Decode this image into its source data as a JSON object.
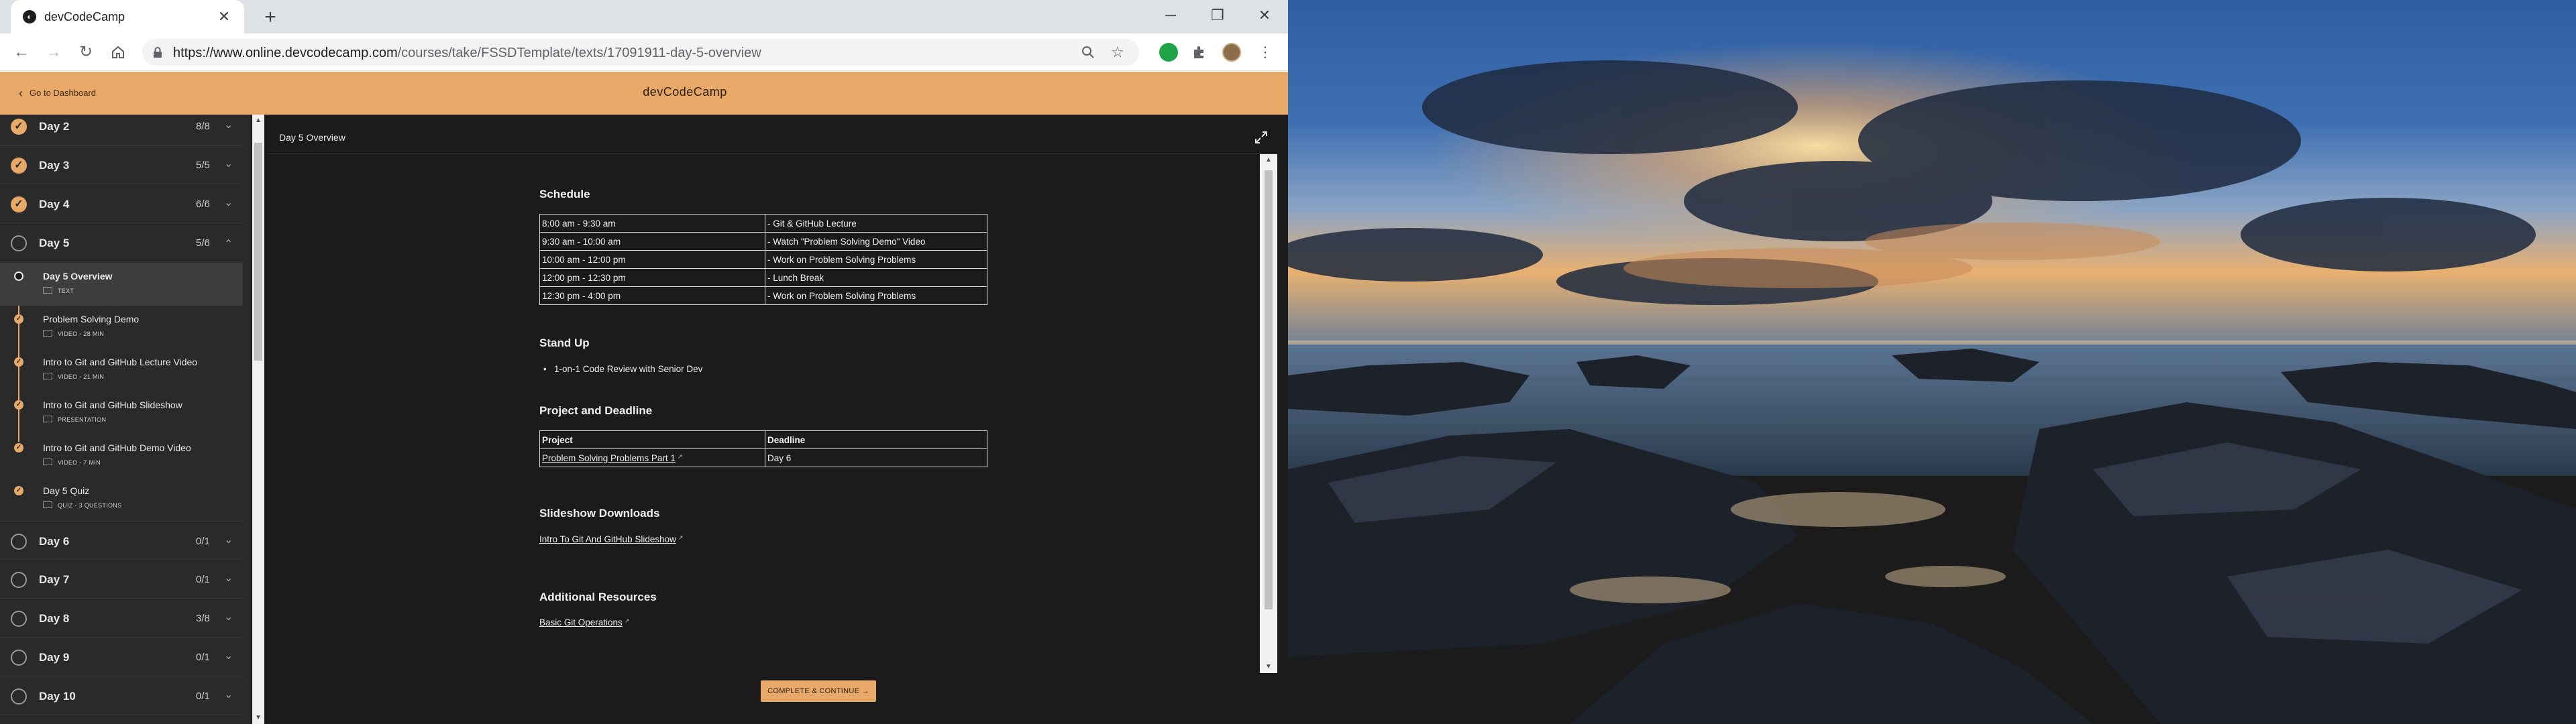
{
  "browser": {
    "tab_title": "devCodeCamp",
    "url_host": "https://www.online.devcodecamp.com",
    "url_path": "/courses/take/FSSDTemplate/texts/17091911-day-5-overview",
    "new_tab": "+",
    "close_tab": "✕",
    "window_controls": {
      "minimize": "─",
      "restore": "❐",
      "close": "✕"
    }
  },
  "app": {
    "brand": "devCodeCamp",
    "dashboard_link": "Go to Dashboard"
  },
  "sidebar": {
    "days": [
      {
        "label": "Day 2",
        "count": "8/8",
        "status": "done"
      },
      {
        "label": "Day 3",
        "count": "5/5",
        "status": "done"
      },
      {
        "label": "Day 4",
        "count": "6/6",
        "status": "done"
      },
      {
        "label": "Day 5",
        "count": "5/6",
        "status": "open",
        "expanded": true
      },
      {
        "label": "Day 6",
        "count": "0/1",
        "status": "open"
      },
      {
        "label": "Day 7",
        "count": "0/1",
        "status": "open"
      },
      {
        "label": "Day 8",
        "count": "3/8",
        "status": "open"
      },
      {
        "label": "Day 9",
        "count": "0/1",
        "status": "open"
      },
      {
        "label": "Day 10",
        "count": "0/1",
        "status": "open"
      }
    ],
    "lessons": [
      {
        "title": "Day 5 Overview",
        "meta": "TEXT",
        "state": "current"
      },
      {
        "title": "Problem Solving Demo",
        "meta": "VIDEO - 28 MIN",
        "state": "done"
      },
      {
        "title": "Intro to Git and GitHub Lecture Video",
        "meta": "VIDEO - 21 MIN",
        "state": "done"
      },
      {
        "title": "Intro to Git and GitHub Slideshow",
        "meta": "PRESENTATION",
        "state": "done"
      },
      {
        "title": "Intro to Git and GitHub Demo Video",
        "meta": "VIDEO - 7 MIN",
        "state": "done"
      },
      {
        "title": "Day 5 Quiz",
        "meta": "QUIZ - 3 QUESTIONS",
        "state": "done"
      }
    ]
  },
  "content": {
    "title": "Day 5 Overview",
    "schedule": {
      "heading": "Schedule",
      "rows": [
        [
          "8:00 am - 9:30 am",
          "- Git & GitHub Lecture"
        ],
        [
          "9:30 am - 10:00 am",
          "- Watch \"Problem Solving Demo\" Video"
        ],
        [
          "10:00 am - 12:00 pm",
          "- Work on Problem Solving Problems"
        ],
        [
          "12:00 pm - 12:30 pm",
          "- Lunch Break"
        ],
        [
          "12:30 pm - 4:00 pm",
          "- Work on Problem Solving Problems"
        ]
      ]
    },
    "standup": {
      "heading": "Stand Up",
      "items": [
        "1-on-1 Code Review with Senior Dev"
      ]
    },
    "project": {
      "heading": "Project and Deadline",
      "col_project": "Project",
      "col_deadline": "Deadline",
      "rows": [
        [
          "Problem Solving Problems Part 1",
          "Day 6"
        ]
      ]
    },
    "slideshow": {
      "heading": "Slideshow Downloads",
      "link": "Intro To Git And GitHub Slideshow"
    },
    "resources": {
      "heading": "Additional Resources",
      "link": "Basic Git Operations"
    },
    "complete_button": "COMPLETE & CONTINUE →"
  },
  "colors": {
    "accent": "#e8a867",
    "sidebar_bg": "#2a2a2a",
    "content_bg": "#1b1b1b"
  }
}
